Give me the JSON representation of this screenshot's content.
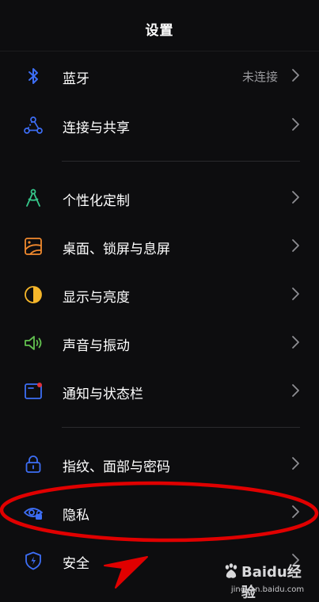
{
  "header": {
    "title": "设置"
  },
  "rows": [
    {
      "id": "bluetooth",
      "label": "蓝牙",
      "value": "未连接",
      "icon": "bluetooth-icon"
    },
    {
      "id": "connection",
      "label": "连接与共享",
      "icon": "share-nodes-icon"
    },
    {
      "id": "personalize",
      "label": "个性化定制",
      "icon": "compass-icon"
    },
    {
      "id": "desktop",
      "label": "桌面、锁屏与息屏",
      "icon": "wallpaper-icon"
    },
    {
      "id": "display",
      "label": "显示与亮度",
      "icon": "brightness-icon"
    },
    {
      "id": "sound",
      "label": "声音与振动",
      "icon": "speaker-icon"
    },
    {
      "id": "notification",
      "label": "通知与状态栏",
      "icon": "notification-icon"
    },
    {
      "id": "fingerprint",
      "label": "指纹、面部与密码",
      "icon": "lock-icon"
    },
    {
      "id": "privacy",
      "label": "隐私",
      "icon": "eye-lock-icon"
    },
    {
      "id": "security",
      "label": "安全",
      "icon": "shield-icon"
    }
  ],
  "colors": {
    "background": "#0d0d0f",
    "icon_blue": "#3d6ef5",
    "icon_green": "#36c88b",
    "icon_orange": "#f28a2e",
    "icon_yellow": "#f5b62a",
    "icon_lime": "#62c04f",
    "annotation_red": "#e00000"
  },
  "watermark": {
    "brand": "Baidu经验",
    "sub": "jingyan.baidu.com"
  }
}
